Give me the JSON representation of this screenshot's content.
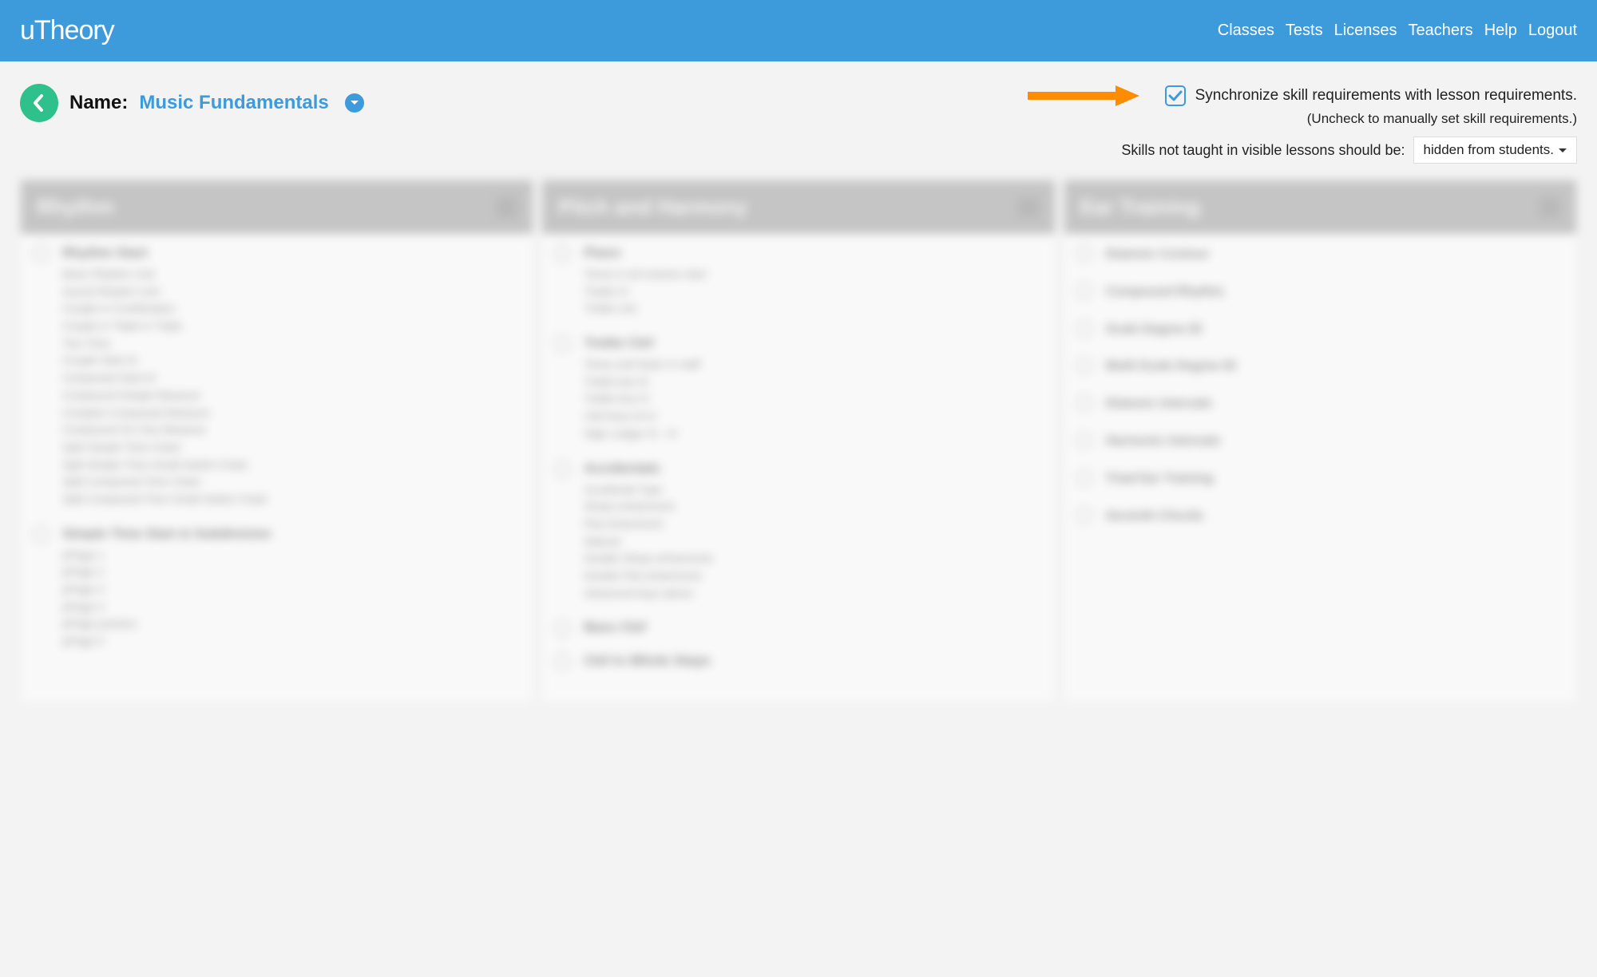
{
  "header": {
    "logo_text": "uTheory",
    "nav": [
      "Classes",
      "Tests",
      "Licenses",
      "Teachers",
      "Help",
      "Logout"
    ]
  },
  "toolbar": {
    "name_label": "Name:",
    "class_name": "Music Fundamentals",
    "sync_label": "Synchronize skill requirements with lesson requirements.",
    "sync_note": "(Uncheck to manually set skill requirements.)",
    "skills_hidden_label": "Skills not taught in visible lessons should be:",
    "skills_select_value": "hidden from students."
  },
  "columns": [
    {
      "title": "Rhythm",
      "blocks": [
        {
          "title": "Rhythm Start",
          "items": [
            "Basic Rhythm Unit",
            "Sound Rhythm Unit",
            "Couple in Combination",
            "Couple in Triple in Triple",
            "Two Time",
            "Couple Start III",
            "Composed Start III",
            "Compound Simple Measure",
            "Complex Composed Measure",
            "Compound On One Measure",
            "Split Simple Time Chain",
            "Split Simple Time Small Switch Chain",
            "Split Composed Time Chain",
            "Split Composed Time Small Switch Chain"
          ]
        },
        {
          "title": "Simple Time Start & Subdivision",
          "items": [
            "pPage 1",
            "pPage 2",
            "pPage 3",
            "pPage 4",
            "pPage practice",
            "pPage 5"
          ]
        }
      ]
    },
    {
      "title": "Pitch and Harmony",
      "blocks": [
        {
          "title": "Piano",
          "items": [
            "Tones in all octaves start",
            "Treble IV",
            "Treble unit"
          ]
        },
        {
          "title": "Treble Clef",
          "items": [
            "Tones and basic in staff",
            "Treble line III",
            "Treble line IV",
            "Clef lines III-IV",
            "High Ledger III - IV"
          ]
        },
        {
          "title": "Accidentals",
          "items": [
            "Accidental Type",
            "Sharp enharmonic",
            "Flat enharmonic",
            "Natural",
            "Double Sharp enharmonic",
            "Double Flat enharmonic",
            "Advanced keys above"
          ]
        },
        {
          "title": "Bass Clef",
          "items": []
        },
        {
          "title": "Clef in Whole Steps",
          "items": []
        }
      ]
    },
    {
      "title": "Ear Training",
      "skills": true,
      "blocks": [
        {
          "title": "Diatonic Contour",
          "items": []
        },
        {
          "title": "Compound Rhythm",
          "items": []
        },
        {
          "title": "Scale Degree ID",
          "items": []
        },
        {
          "title": "Multi-Scale Degree ID",
          "items": []
        },
        {
          "title": "Diatonic Intervals",
          "items": []
        },
        {
          "title": "Harmonic Intervals",
          "items": []
        },
        {
          "title": "Triad Ear Training",
          "items": []
        },
        {
          "title": "Seventh Chords",
          "items": []
        }
      ]
    }
  ]
}
